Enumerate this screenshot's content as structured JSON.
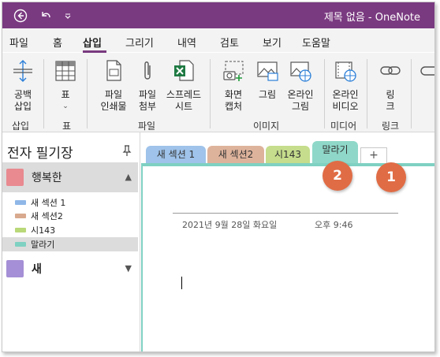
{
  "titlebar": {
    "title": "제목 없음  -  OneNote"
  },
  "menu": {
    "items": [
      "파일",
      "홈",
      "삽입",
      "그리기",
      "내역",
      "검토",
      "보기",
      "도움말"
    ],
    "active": "삽입"
  },
  "ribbon": {
    "buttons": {
      "space": "공백\n삽입",
      "table": "표",
      "printout": "파일\n인쇄물",
      "attach": "파일\n첨부",
      "spreadsheet": "스프레드\n시트",
      "screenshot": "화면\n캡처",
      "picture": "그림",
      "online_picture": "온라인\n그림",
      "online_video": "온라인\n비디오",
      "link": "링\n크"
    },
    "groups": {
      "insert": "삽입",
      "tables": "표",
      "files": "파일",
      "images": "이미지",
      "media": "미디어",
      "links": "링크"
    }
  },
  "notebooks": {
    "title": "전자 필기장",
    "items": [
      {
        "name": "행복한",
        "color": "#e88a90",
        "expanded": true
      },
      {
        "name": "새",
        "color": "#a58fd6",
        "expanded": false
      }
    ],
    "sections": [
      {
        "name": "새 섹션 1",
        "color": "#8fb8e8"
      },
      {
        "name": "새 섹션2",
        "color": "#d8a98e"
      },
      {
        "name": "시143",
        "color": "#b9d878"
      },
      {
        "name": "말라기",
        "color": "#7fd1c2",
        "selected": true
      }
    ]
  },
  "tabs": [
    {
      "label": "새 섹션 1",
      "color": "#9fc3ea"
    },
    {
      "label": "새 섹션2",
      "color": "#deb39c"
    },
    {
      "label": "시143",
      "color": "#c5dd8c"
    },
    {
      "label": "말라기",
      "color": "#8fd8c9"
    }
  ],
  "add_tab": "+",
  "page": {
    "date": "2021년 9월 28일 화요일",
    "time": "오후 9:46"
  },
  "badges": {
    "first": "1",
    "second": "2"
  }
}
